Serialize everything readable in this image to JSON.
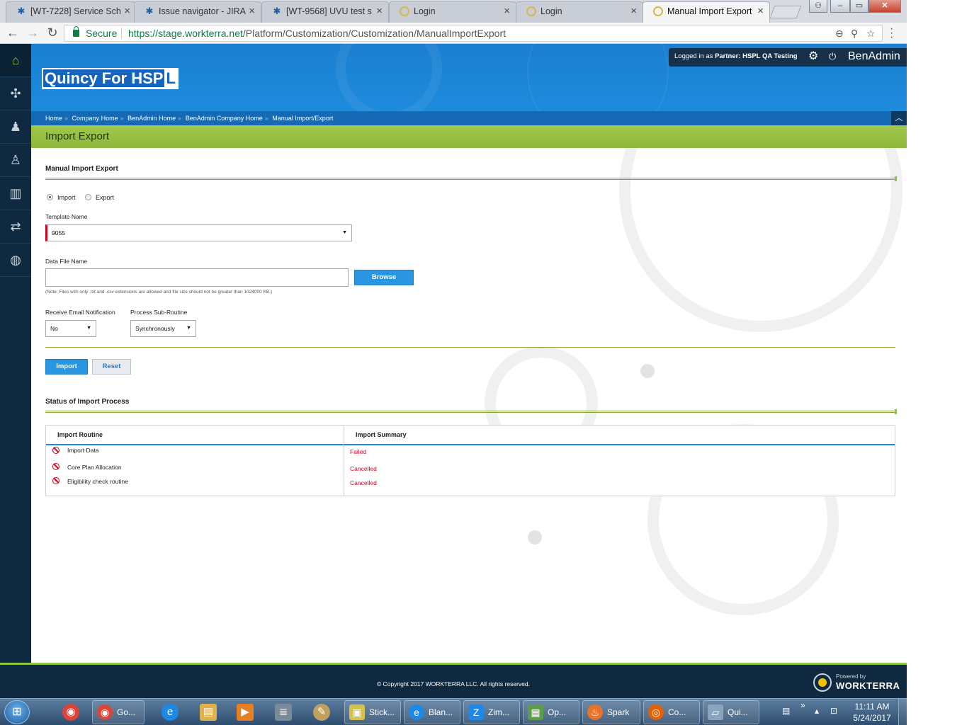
{
  "browser": {
    "tabs": [
      {
        "title": "[WT-7228] Service Sch",
        "icon": "jira-icon"
      },
      {
        "title": "Issue navigator - JIRA",
        "icon": "jira-icon"
      },
      {
        "title": "[WT-9568] UVU test s",
        "icon": "jira-icon"
      },
      {
        "title": "Login",
        "icon": "login-icon"
      },
      {
        "title": "Login",
        "icon": "login-icon"
      },
      {
        "title": "Manual Import Export",
        "icon": "login-icon"
      }
    ],
    "secure_label": "Secure",
    "url_scheme": "https://",
    "url_domain": "stage.workterra.net",
    "url_path": "/Platform/Customization/Customization/ManualImportExport"
  },
  "header": {
    "brand_prefix": "Quincy For HSP",
    "brand_suffix": "L",
    "logged_in_text": "Logged in as",
    "partner_label": "Partner:",
    "partner_name": "HSPL QA Testing",
    "app_name": "BenAdmin"
  },
  "breadcrumb": [
    "Home",
    "Company Home",
    "BenAdmin Home",
    "BenAdmin Company Home",
    "Manual Import/Export"
  ],
  "breadcrumb_divider": "»",
  "page_title": "Import Export",
  "form": {
    "section_title": "Manual Import Export",
    "radio_import": "Import",
    "radio_export": "Export",
    "template_label": "Template Name",
    "template_value": "9055",
    "datafile_label": "Data File Name",
    "browse_label": "Browse",
    "note": "(Note: Files with only .txt and .csv extensions are allowed and file size should not be greater than 1024000 KB.)",
    "email_label": "Receive Email Notification",
    "email_value": "No",
    "subroutine_label": "Process Sub-Routine",
    "subroutine_value": "Synchronously",
    "import_button": "Import",
    "reset_button": "Reset"
  },
  "status": {
    "section_title": "Status of Import Process",
    "col_routine": "Import Routine",
    "col_summary": "Import Summary",
    "rows": [
      {
        "routine": "Import Data",
        "summary": "Failed"
      },
      {
        "routine": "Core Plan Allocation",
        "summary": "Cancelled"
      },
      {
        "routine": "Eligibility check routine",
        "summary": "Cancelled"
      }
    ]
  },
  "footer": {
    "copyright": "© Copyright 2017 WORKTERRA LLC. All rights reserved.",
    "powered_by": "Powered by",
    "brand": "WORKTERRA"
  },
  "taskbar": {
    "items": [
      "Go...",
      "Stick...",
      "Blan...",
      "Zim...",
      "Op...",
      "Spark",
      "Co...",
      "Qui..."
    ],
    "time": "11:11 AM",
    "date": "5/24/2017"
  },
  "colors": {
    "header_blue": "#1e8ee0",
    "accent_green": "#8cc63e",
    "sidebar_navy": "#0f2a40",
    "error_red": "#d0021b"
  }
}
